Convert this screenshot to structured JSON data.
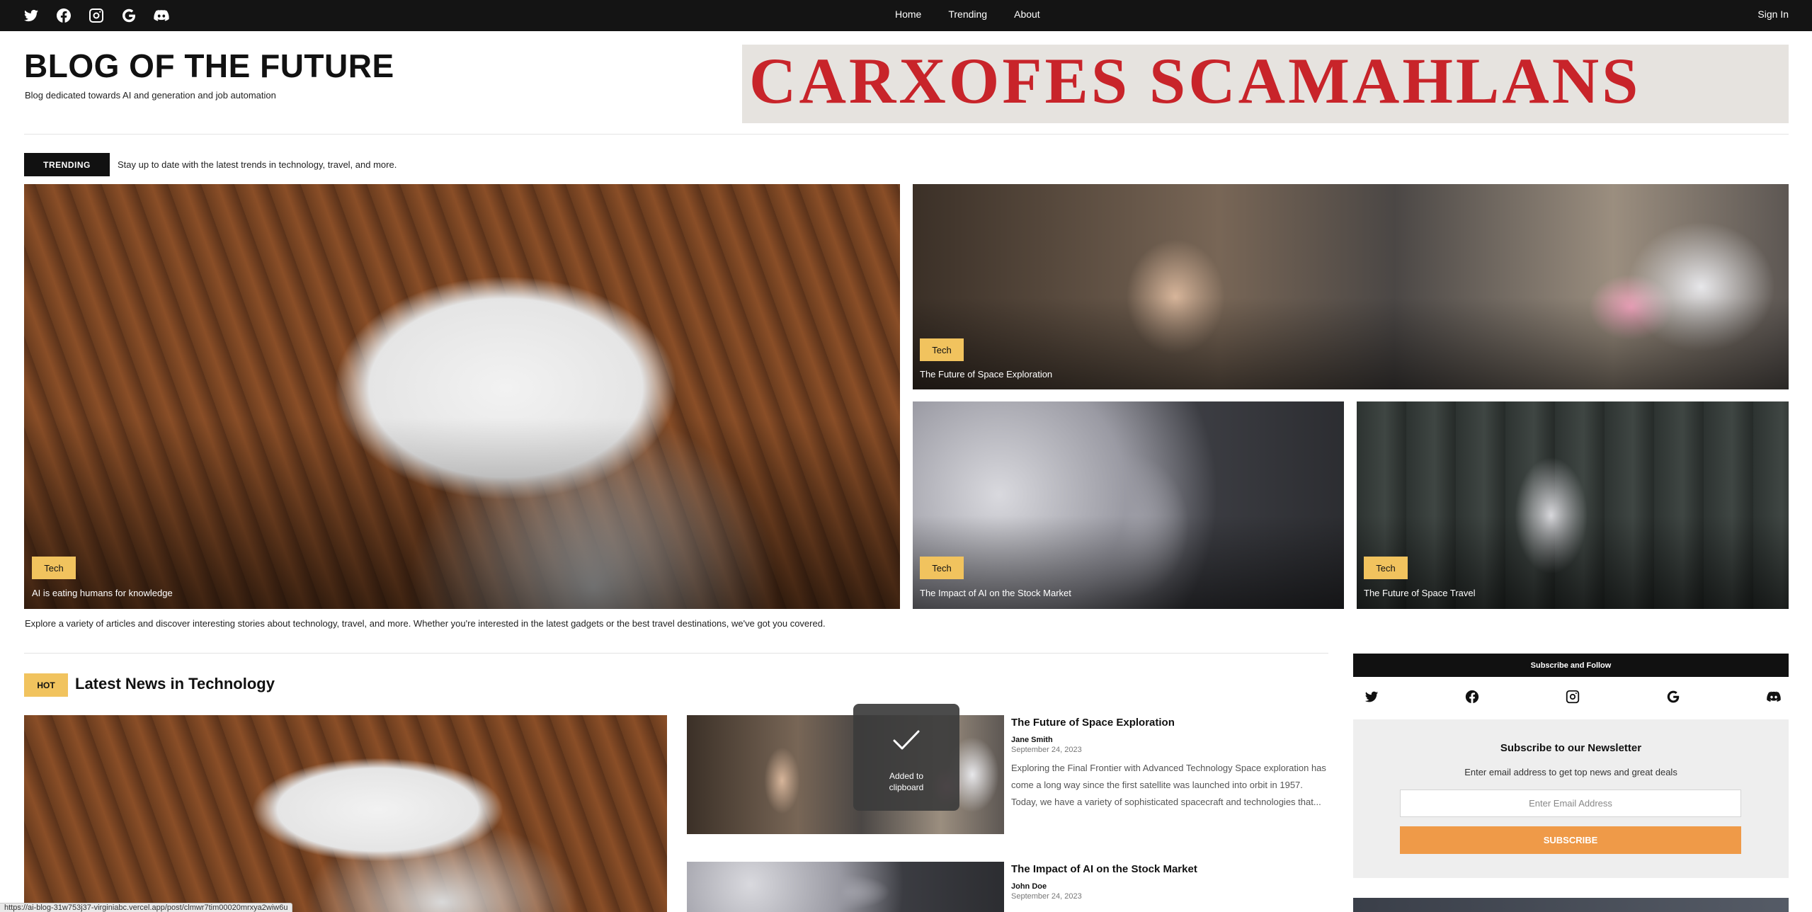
{
  "nav": {
    "links": [
      "Home",
      "Trending",
      "About"
    ],
    "sign_in": "Sign In",
    "social_icons": [
      "twitter-icon",
      "facebook-icon",
      "instagram-icon",
      "google-icon",
      "discord-icon"
    ]
  },
  "header": {
    "title": "BLOG OF THE FUTURE",
    "subtitle": "Blog dedicated towards AI and generation and job automation",
    "banner_text": "CARXOFES SCAMAHLANS"
  },
  "trending": {
    "badge": "TRENDING",
    "text": "Stay up to date with the latest trends in technology, travel, and more."
  },
  "featured": [
    {
      "tag": "Tech",
      "title": "AI is eating humans for knowledge"
    },
    {
      "tag": "Tech",
      "title": "The Future of Space Exploration"
    },
    {
      "tag": "Tech",
      "title": "The Impact of AI on the Stock Market"
    },
    {
      "tag": "Tech",
      "title": "The Future of Space Travel"
    }
  ],
  "intro": "Explore a variety of articles and discover interesting stories about technology, travel, and more. Whether you're interested in the latest gadgets or the best travel destinations, we've got you covered.",
  "hot": {
    "badge": "HOT",
    "title": "Latest News in Technology"
  },
  "posts": [
    {
      "title": "The Future of Space Exploration",
      "author": "Jane Smith",
      "date": "September 24, 2023",
      "excerpt": "Exploring the Final Frontier with Advanced Technology Space exploration has come a long way since the first satellite was launched into orbit in 1957. Today, we have a variety of sophisticated spacecraft and technologies that..."
    },
    {
      "title": "The Impact of AI on the Stock Market",
      "author": "John Doe",
      "date": "September 24, 2023"
    }
  ],
  "toast": {
    "line1": "Added to",
    "line2": "clipboard"
  },
  "sidebar": {
    "header": "Subscribe and Follow",
    "newsletter_title": "Subscribe to our Newsletter",
    "newsletter_sub": "Enter email address to get top news and great deals",
    "email_placeholder": "Enter Email Address",
    "subscribe_label": "SUBSCRIBE"
  },
  "status_url": "https://ai-blog-31w753j37-virginiabc.vercel.app/post/clmwr7tim00020mrxya2wiw6u",
  "colors": {
    "accent_yellow": "#f1c35e",
    "subscribe_orange": "#ef9a48",
    "nav_bg": "#141414"
  }
}
